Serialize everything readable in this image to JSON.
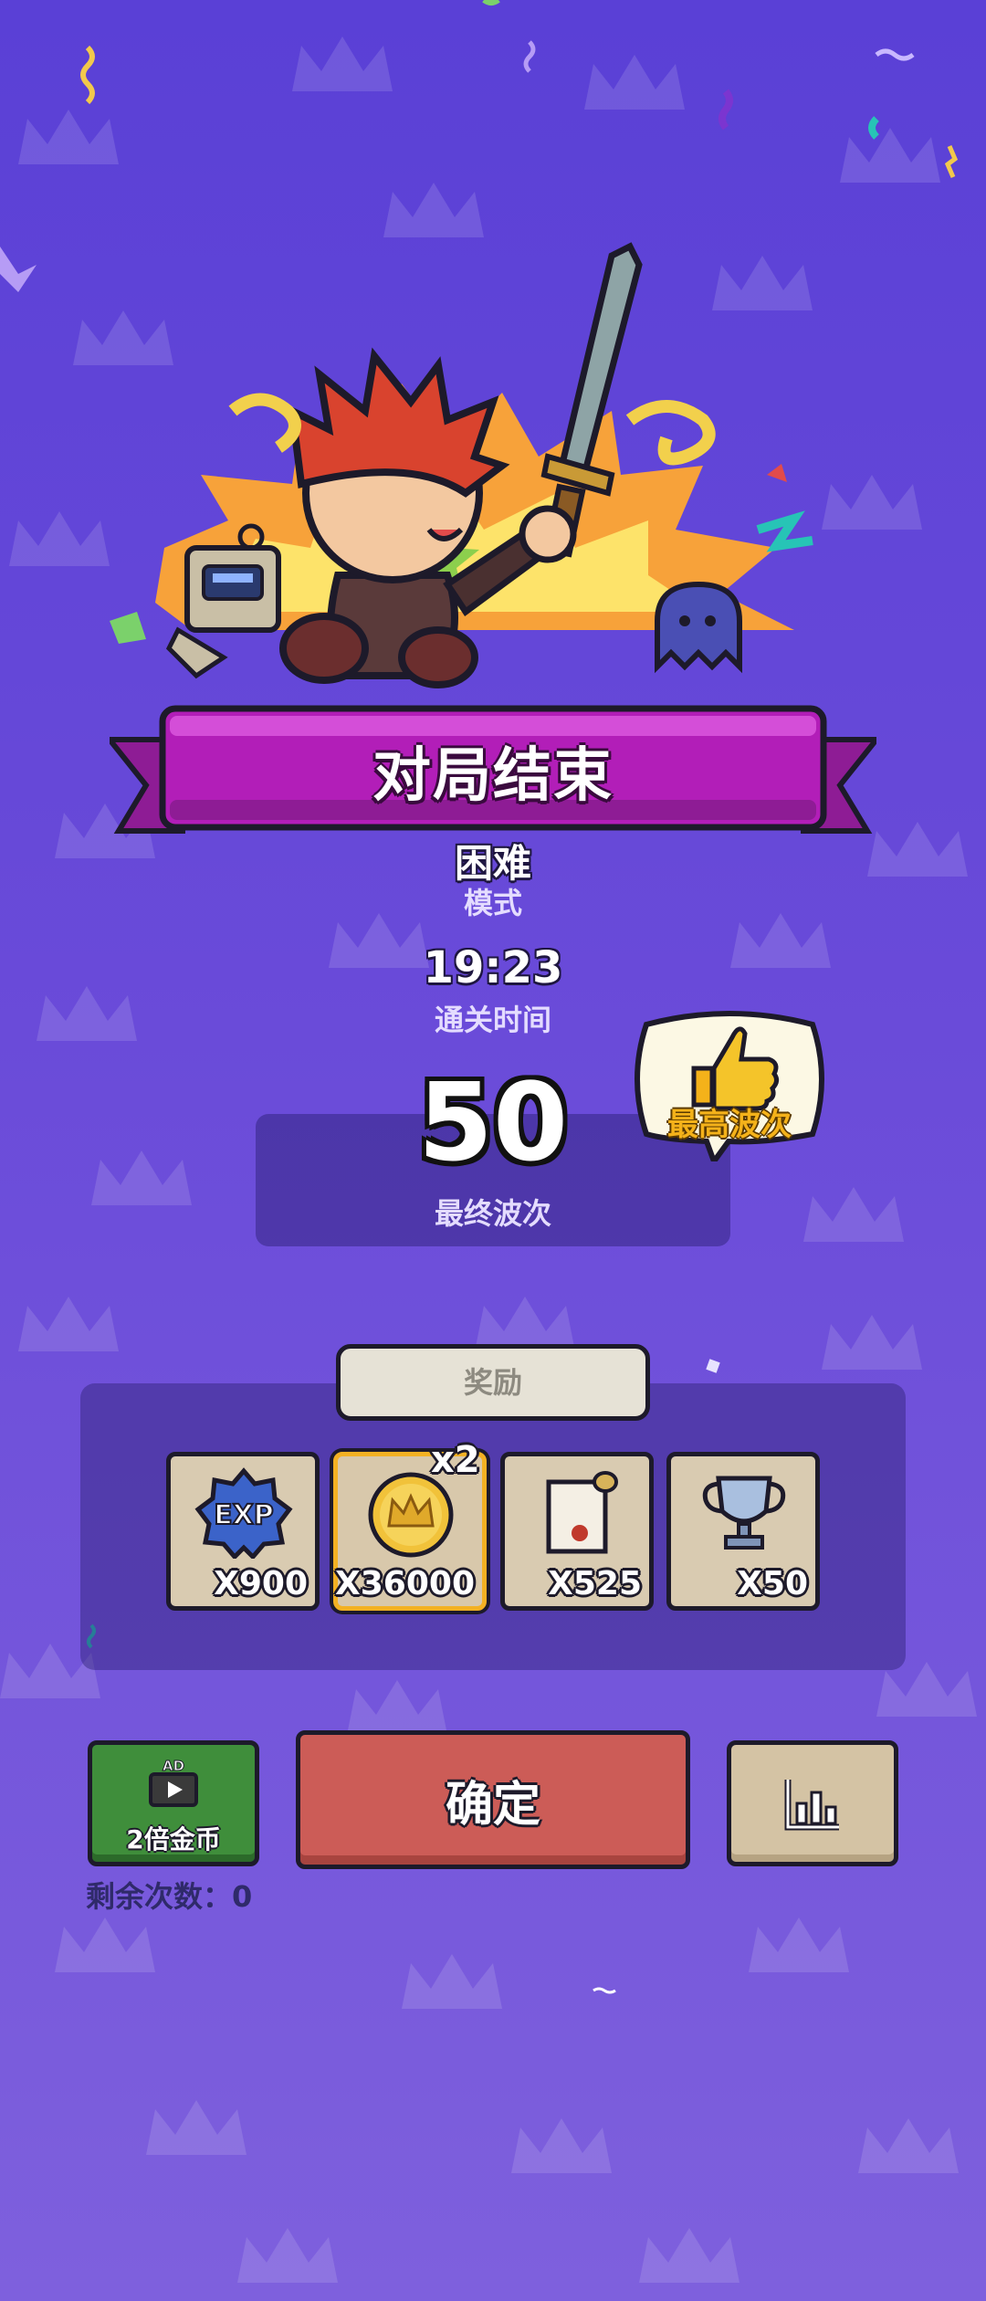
{
  "banner": {
    "title": "对局结束"
  },
  "mode": {
    "value": "困难",
    "label": "模式"
  },
  "clear_time": {
    "value": "19:23",
    "label": "通关时间"
  },
  "final_wave": {
    "value": "50",
    "label": "最终波次"
  },
  "best_badge": {
    "label": "最高波次",
    "icon": "thumbs-up-icon"
  },
  "rewards": {
    "tab_label": "奖励",
    "multiplier": "x2",
    "items": [
      {
        "icon": "exp-badge-icon",
        "badge_text": "EXP",
        "quantity": "X900"
      },
      {
        "icon": "gold-crown-coin-icon",
        "quantity": "X36000"
      },
      {
        "icon": "scroll-icon",
        "quantity": "X525"
      },
      {
        "icon": "trophy-icon",
        "quantity": "X50"
      }
    ]
  },
  "buttons": {
    "ad_badge": "AD",
    "ad_label": "2倍金币",
    "confirm_label": "确定",
    "stats_icon": "bar-chart-icon"
  },
  "remaining": {
    "text": "剩余次数：0"
  },
  "colors": {
    "background": "#6a4bd9",
    "banner": "#b21eb8",
    "confirm": "#cc5c57",
    "ad": "#3f8e3b",
    "stats": "#d4c3a4",
    "highlight": "#f3b123"
  }
}
